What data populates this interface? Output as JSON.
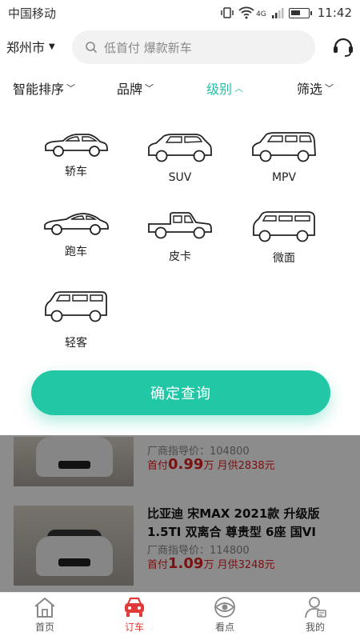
{
  "status": {
    "carrier": "中国移动",
    "time": "11:42",
    "network": "4G"
  },
  "header": {
    "city": "郑州市",
    "search_placeholder": "低首付 爆款新车"
  },
  "filters": [
    {
      "label": "智能排序",
      "active": false
    },
    {
      "label": "品牌",
      "active": false
    },
    {
      "label": "级别",
      "active": true
    },
    {
      "label": "筛选",
      "active": false
    }
  ],
  "categories": [
    {
      "label": "轿车",
      "icon": "sedan-icon"
    },
    {
      "label": "SUV",
      "icon": "suv-icon"
    },
    {
      "label": "MPV",
      "icon": "mpv-icon"
    },
    {
      "label": "跑车",
      "icon": "sports-car-icon"
    },
    {
      "label": "皮卡",
      "icon": "pickup-icon"
    },
    {
      "label": "微面",
      "icon": "minivan-icon"
    },
    {
      "label": "轻客",
      "icon": "light-bus-icon"
    }
  ],
  "confirm_label": "确定查询",
  "listings": [
    {
      "title": "",
      "guide": "厂商指导价：104800",
      "down_prefix": "首付",
      "down_value": "0.99",
      "down_unit": "万",
      "monthly": "月供2838元"
    },
    {
      "title": "比亚迪 宋MAX 2021款 升级版 1.5TI 双离合 尊贵型 6座 国VI",
      "guide": "厂商指导价：114800",
      "down_prefix": "首付",
      "down_value": "1.09",
      "down_unit": "万",
      "monthly": "月供3248元"
    }
  ],
  "nav": [
    {
      "label": "首页",
      "active": false
    },
    {
      "label": "订车",
      "active": true
    },
    {
      "label": "看点",
      "active": false
    },
    {
      "label": "我的",
      "active": false
    }
  ],
  "colors": {
    "accent": "#22c8a6",
    "price_red": "#e02020",
    "nav_active": "#e03a3a"
  }
}
